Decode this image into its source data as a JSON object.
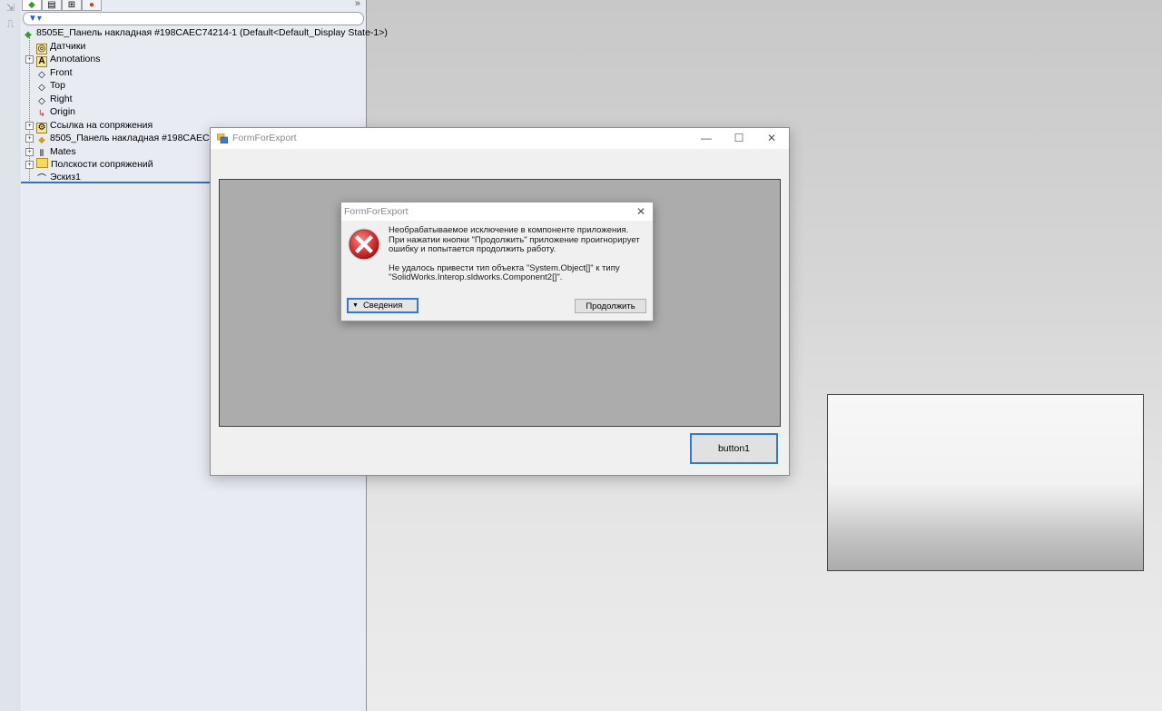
{
  "feature_tree": {
    "root": "8505E_Панель накладная #198CAEC74214-1  (Default<Default_Display State-1>)",
    "items": [
      {
        "label": "Датчики",
        "icon": "sensor-icon",
        "expandable": false
      },
      {
        "label": "Annotations",
        "icon": "annotation-icon",
        "expandable": true
      },
      {
        "label": "Front",
        "icon": "plane-icon",
        "expandable": false
      },
      {
        "label": "Top",
        "icon": "plane-icon",
        "expandable": false
      },
      {
        "label": "Right",
        "icon": "plane-icon",
        "expandable": false
      },
      {
        "label": "Origin",
        "icon": "origin-icon",
        "expandable": false
      },
      {
        "label": "Ссылка на сопряжения",
        "icon": "mate-reference-icon",
        "expandable": true
      },
      {
        "label": "8505_Панель накладная #198CAEC74214",
        "icon": "part-icon",
        "expandable": true
      },
      {
        "label": "Mates",
        "icon": "mates-icon",
        "expandable": true
      },
      {
        "label": "Полскости сопряжений",
        "icon": "folder-icon",
        "expandable": true
      },
      {
        "label": "Эскиз1",
        "icon": "sketch-icon",
        "expandable": false
      }
    ],
    "tabs_expand": "»"
  },
  "main_window": {
    "title": "FormForExport",
    "minimize": "—",
    "maximize": "☐",
    "close": "✕",
    "button1_label": "button1"
  },
  "error_dialog": {
    "title": "FormForExport",
    "close": "✕",
    "message_1": "Необрабатываемое исключение в компоненте приложения. При нажатии кнопки \"Продолжить\" приложение проигнорирует ошибку и попытается продолжить работу.",
    "message_2": "Не удалось привести тип объекта \"System.Object[]\" к типу \"SolidWorks.Interop.sldworks.Component2[]\".",
    "details_label": "Сведения",
    "continue_label": "Продолжить",
    "icon": "error-icon"
  },
  "colors": {
    "accent": "#2e7ad6",
    "error_red": "#d93a3a"
  }
}
